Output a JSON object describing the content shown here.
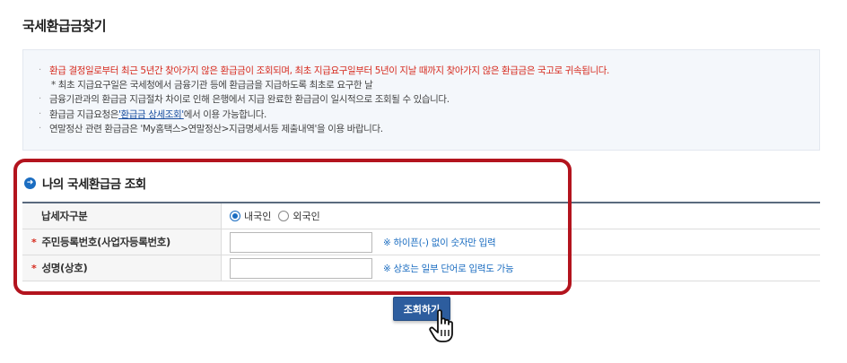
{
  "page": {
    "title": "국세환급금찾기"
  },
  "notice": {
    "lines": [
      {
        "text": "환급 결정일로부터 최근 5년간 찾아가지 않은 환급금이 조회되며, 최초 지급요구일부터 5년이 지날 때까지 찾아가지 않은 환급금은 국고로 귀속됩니다."
      },
      {
        "text": "* 최초 지급요구일은 국세청에서 금융기관 등에 환급금을 지급하도록 최초로 요구한 날"
      },
      {
        "text": "금융기관과의 환급금 지급절차 차이로 인해 은행에서 지급 완료한 환급금이 일시적으로 조회될 수 있습니다."
      },
      {
        "before": "환급금 지급요청은 ",
        "link": "'환급금 상세조회'",
        "after": "에서 이용 가능합니다."
      },
      {
        "text": "연말정산 관련 환급금은 'My홈택스>연말정산>지급명세서등 제출내역'을 이용 바랍니다."
      }
    ]
  },
  "section": {
    "title": "나의 국세환급금 조회"
  },
  "form": {
    "taxpayer_type": {
      "label": "납세자구분",
      "options": [
        "내국인",
        "외국인"
      ],
      "selected": "내국인"
    },
    "rrn": {
      "label": "주민등록번호(사업자등록번호)",
      "value": "",
      "hint": "※ 하이픈(-) 없이 숫자만 입력"
    },
    "name": {
      "label": "성명(상호)",
      "value": "",
      "hint": "※ 상호는 일부 단어로 입력도 가능"
    }
  },
  "actions": {
    "search_label": "조회하기"
  },
  "colors": {
    "accent": "#1b6dc1",
    "alert_red": "#d62b1f",
    "button": "#2d5d9e",
    "frame": "#b3141e"
  }
}
